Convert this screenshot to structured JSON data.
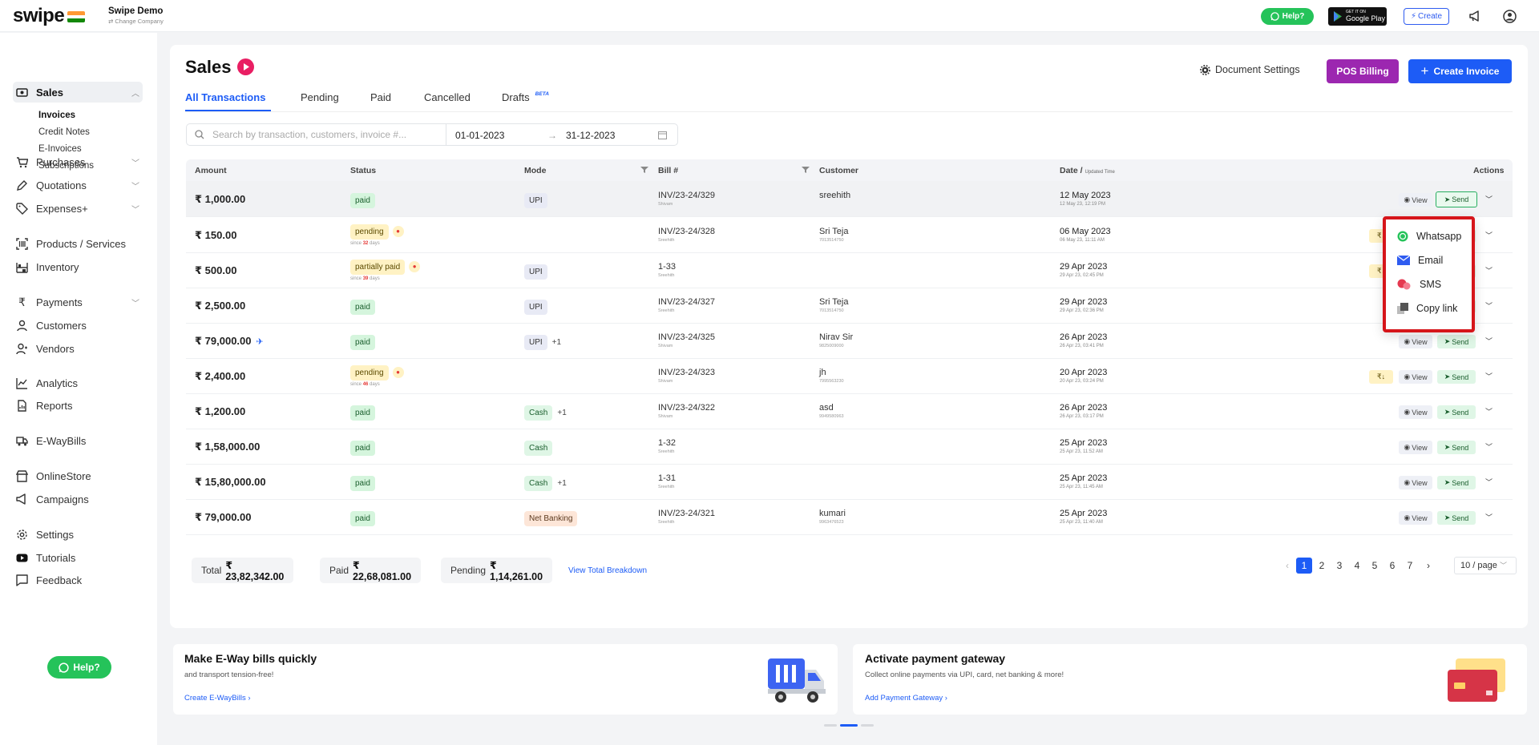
{
  "app": {
    "logo": "swipe",
    "company_name": "Swipe Demo",
    "change_company": "⇄ Change Company"
  },
  "topbar": {
    "help": "Help?",
    "gplay_small": "GET IT ON",
    "gplay_big": "Google Play",
    "create": "Create"
  },
  "sidebar": {
    "sales": "Sales",
    "sub": [
      "Invoices",
      "Credit Notes",
      "E-Invoices",
      "Subscriptions"
    ],
    "items": [
      "Purchases",
      "Quotations",
      "Expenses+",
      "Products / Services",
      "Inventory",
      "Payments",
      "Customers",
      "Vendors",
      "Analytics",
      "Reports",
      "E-WayBills",
      "OnlineStore",
      "Campaigns",
      "Settings",
      "Tutorials",
      "Feedback"
    ],
    "help": "Help?"
  },
  "main": {
    "title": "Sales",
    "doc_settings": "Document Settings",
    "pos": "POS Billing",
    "create_invoice": "Create Invoice",
    "tabs": [
      "All Transactions",
      "Pending",
      "Paid",
      "Cancelled",
      "Drafts"
    ],
    "beta": "BETA",
    "search_placeholder": "Search by transaction, customers, invoice #...",
    "date_from": "01-01-2023",
    "date_to": "31-12-2023",
    "date_sep": "→"
  },
  "table": {
    "headers": {
      "amount": "Amount",
      "status": "Status",
      "mode": "Mode",
      "bill": "Bill #",
      "customer": "Customer",
      "date": "Date /",
      "date_small": "Updated Time",
      "actions": "Actions"
    },
    "view": "View",
    "send": "Send",
    "rows": [
      {
        "amount": "₹ 1,000.00",
        "status": "paid",
        "since": "",
        "mode": "UPI",
        "mode_extra": "",
        "bill": "INV/23-24/329",
        "bill_sub": "Shivam",
        "customer": "sreehith",
        "phone": "",
        "date": "12 May 2023",
        "time": "12 May 23, 12:19 PM"
      },
      {
        "amount": "₹ 150.00",
        "status": "pending",
        "since": "32",
        "mode": "",
        "mode_extra": "",
        "bill": "INV/23-24/328",
        "bill_sub": "Sreehith",
        "customer": "Sri Teja",
        "phone": "7013514750",
        "date": "06 May 2023",
        "time": "06 May 23, 11:11 AM"
      },
      {
        "amount": "₹ 500.00",
        "status": "partially paid",
        "since": "39",
        "mode": "UPI",
        "mode_extra": "",
        "bill": "1-33",
        "bill_sub": "Sreehith",
        "customer": "",
        "phone": "",
        "date": "29 Apr 2023",
        "time": "29 Apr 23, 02:45 PM"
      },
      {
        "amount": "₹ 2,500.00",
        "status": "paid",
        "since": "",
        "mode": "UPI",
        "mode_extra": "",
        "bill": "INV/23-24/327",
        "bill_sub": "Sreehith",
        "customer": "Sri Teja",
        "phone": "7013514750",
        "date": "29 Apr 2023",
        "time": "29 Apr 23, 02:36 PM"
      },
      {
        "amount": "₹ 79,000.00",
        "status": "paid",
        "since": "",
        "mode": "UPI",
        "mode_extra": "+1",
        "bill": "INV/23-24/325",
        "bill_sub": "Shivam",
        "customer": "Nirav Sir",
        "phone": "9825009000",
        "date": "26 Apr 2023",
        "time": "26 Apr 23, 03:41 PM"
      },
      {
        "amount": "₹ 2,400.00",
        "status": "pending",
        "since": "46",
        "mode": "",
        "mode_extra": "",
        "bill": "INV/23-24/323",
        "bill_sub": "Shivam",
        "customer": "jh",
        "phone": "7995563230",
        "date": "20 Apr 2023",
        "time": "20 Apr 23, 03:24 PM"
      },
      {
        "amount": "₹ 1,200.00",
        "status": "paid",
        "since": "",
        "mode": "Cash",
        "mode_extra": "+1",
        "bill": "INV/23-24/322",
        "bill_sub": "Shivam",
        "customer": "asd",
        "phone": "9949580963",
        "date": "26 Apr 2023",
        "time": "26 Apr 23, 03:17 PM"
      },
      {
        "amount": "₹ 1,58,000.00",
        "status": "paid",
        "since": "",
        "mode": "Cash",
        "mode_extra": "",
        "bill": "1-32",
        "bill_sub": "Sreehith",
        "customer": "",
        "phone": "",
        "date": "25 Apr 2023",
        "time": "25 Apr 23, 11:52 AM"
      },
      {
        "amount": "₹ 15,80,000.00",
        "status": "paid",
        "since": "",
        "mode": "Cash",
        "mode_extra": "+1",
        "bill": "1-31",
        "bill_sub": "Sreehith",
        "customer": "",
        "phone": "",
        "date": "25 Apr 2023",
        "time": "25 Apr 23, 11:45 AM"
      },
      {
        "amount": "₹ 79,000.00",
        "status": "paid",
        "since": "",
        "mode": "Net Banking",
        "mode_extra": "",
        "bill": "INV/23-24/321",
        "bill_sub": "Sreehith",
        "customer": "kumari",
        "phone": "9963476523",
        "date": "25 Apr 2023",
        "time": "25 Apr 23, 11:40 AM"
      }
    ]
  },
  "totals": {
    "total_label": "Total",
    "total": "₹ 23,82,342.00",
    "paid_label": "Paid",
    "paid": "₹ 22,68,081.00",
    "pending_label": "Pending",
    "pending": "₹ 1,14,261.00",
    "breakdown": "View Total Breakdown"
  },
  "pagination": {
    "pages": [
      "1",
      "2",
      "3",
      "4",
      "5",
      "6",
      "7"
    ],
    "per_page": "10 / page"
  },
  "send_menu": [
    "Whatsapp",
    "Email",
    "SMS",
    "Copy link"
  ],
  "promos": [
    {
      "title": "Make E-Way bills quickly",
      "sub": "and transport tension-free!",
      "link": "Create E-WayBills"
    },
    {
      "title": "Activate payment gateway",
      "sub": "Collect online payments via UPI, card, net banking & more!",
      "link": "Add Payment Gateway"
    }
  ],
  "colors": {
    "primary": "#1d5cf6",
    "whatsapp": "#25c35a",
    "pos": "#9c27b0",
    "paid_bg": "#d5f5dd",
    "pending_bg": "#fff2c4",
    "highlight": "#d6151a"
  }
}
